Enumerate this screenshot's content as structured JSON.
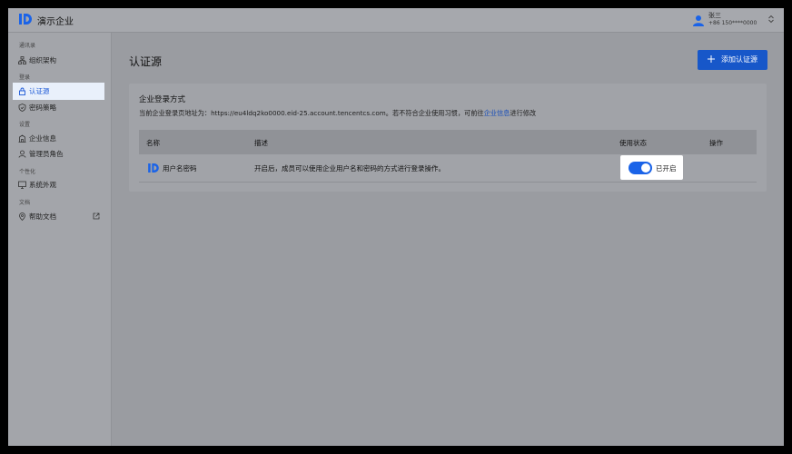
{
  "app": {
    "title": "演示企业"
  },
  "user": {
    "name": "张三",
    "phone": "+86 150****0000"
  },
  "sidebar": {
    "sections": [
      {
        "label": "通讯录",
        "items": [
          {
            "label": "组织架构",
            "icon": "org-icon"
          }
        ]
      },
      {
        "label": "登录",
        "items": [
          {
            "label": "认证源",
            "icon": "lock-icon",
            "active": true
          },
          {
            "label": "密码策略",
            "icon": "shield-icon"
          }
        ]
      },
      {
        "label": "设置",
        "items": [
          {
            "label": "企业信息",
            "icon": "building-icon"
          },
          {
            "label": "管理员角色",
            "icon": "admin-icon"
          }
        ]
      },
      {
        "label": "个性化",
        "items": [
          {
            "label": "系统外观",
            "icon": "monitor-icon"
          }
        ]
      },
      {
        "label": "文档",
        "items": [
          {
            "label": "帮助文档",
            "icon": "location-icon",
            "external": true
          }
        ]
      }
    ]
  },
  "main": {
    "title": "认证源",
    "add_button": "添加认证源",
    "card": {
      "title": "企业登录方式",
      "desc_prefix": "当前企业登录页地址为：https://eu4ldq2ko0000.eid-25.account.tencentcs.com。若不符合企业使用习惯，可前往",
      "desc_link": "企业信息",
      "desc_suffix": "进行修改"
    },
    "table": {
      "columns": [
        "名称",
        "描述",
        "使用状态",
        "操作"
      ],
      "rows": [
        {
          "name": "用户名密码",
          "desc": "开启后，成员可以使用企业用户名和密码的方式进行登录操作。",
          "status": "已开启",
          "enabled": true
        }
      ]
    }
  },
  "colors": {
    "accent": "#1757c9",
    "toggle_on": "#1a63e8",
    "active_bg": "#e9f0fb"
  }
}
